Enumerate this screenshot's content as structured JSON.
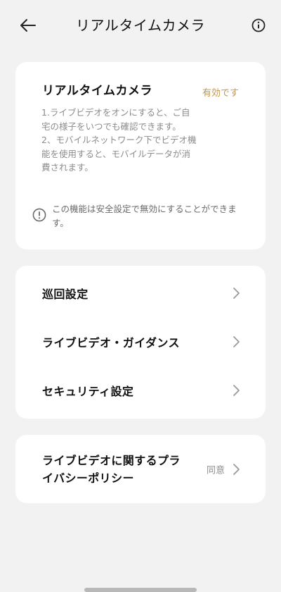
{
  "header": {
    "title": "リアルタイムカメラ",
    "back_icon": "arrow-left-icon",
    "info_icon": "info-circle-icon"
  },
  "camera_card": {
    "title": "リアルタイムカメラ",
    "status": "有効です",
    "status_color": "#c0964e",
    "description_1": "1.ライブビデオをオンにすると、ご自宅の様子をいつでも確認できます。",
    "description_2": "2、モバイルネットワーク下でビデオ機能を使用すると、モバイルデータが消費されます。",
    "notice_icon": "exclamation-circle-icon",
    "notice": "この機能は安全設定で無効にすることができます。"
  },
  "settings": {
    "items": [
      {
        "label": "巡回設定"
      },
      {
        "label": "ライブビデオ・ガイダンス"
      },
      {
        "label": "セキュリティ設定"
      }
    ]
  },
  "privacy": {
    "label": "ライブビデオに関するプライバシーポリシー",
    "value": "同意"
  }
}
